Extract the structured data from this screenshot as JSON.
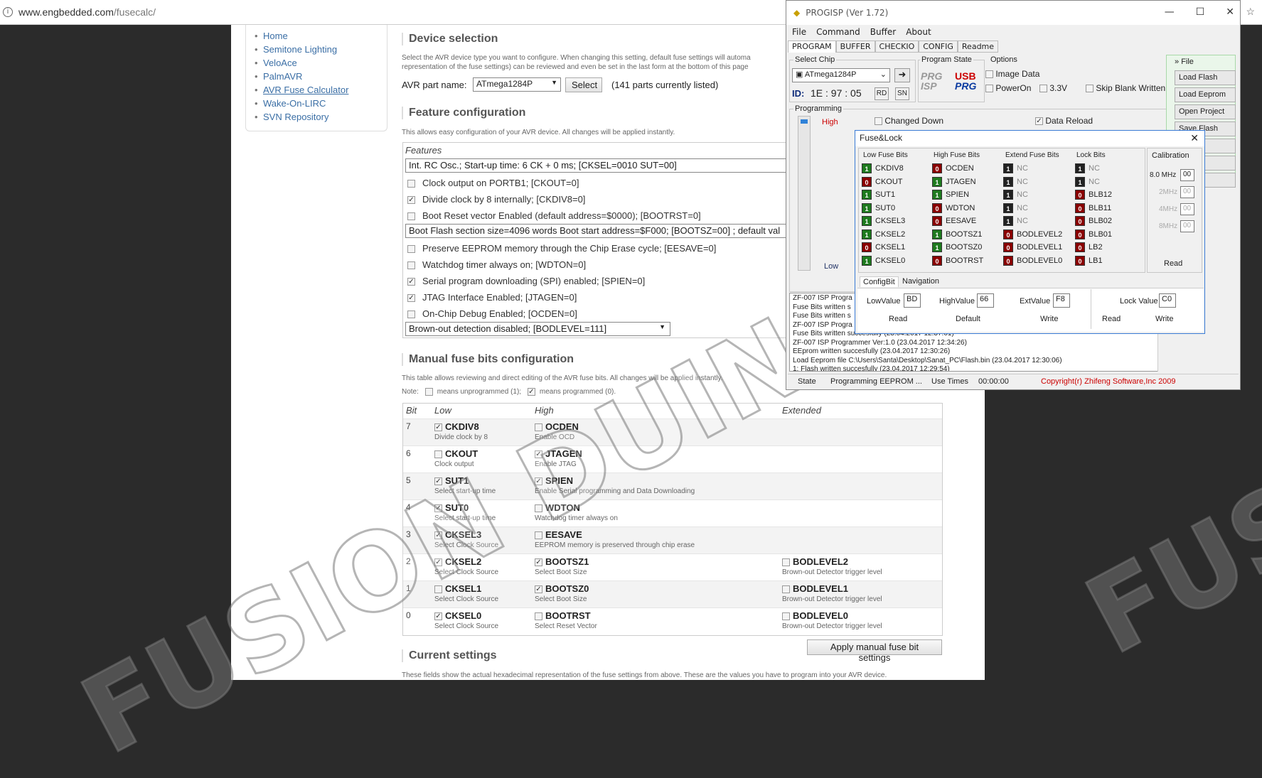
{
  "browser": {
    "url_host": "www.engbedded.com",
    "url_path": "/fusecalc/"
  },
  "sidenav": [
    "Home",
    "Semitone Lighting",
    "VeloAce",
    "PalmAVR",
    "AVR Fuse Calculator",
    "Wake-On-LIRC",
    "SVN Repository"
  ],
  "device": {
    "heading": "Device selection",
    "desc1": "Select the AVR device type you want to configure. When changing this setting, default fuse settings will automa",
    "desc2": "representation of the fuse settings) can be reviewed and even be set in the last form at the bottom of this page",
    "part_label": "AVR part name:",
    "part_value": "ATmega1284P",
    "select_btn": "Select",
    "count": "(141 parts currently listed)"
  },
  "features": {
    "heading": "Feature configuration",
    "desc": "This allows easy configuration of your AVR device. All changes will be applied instantly.",
    "box_label": "Features",
    "osc": "Int. RC Osc.; Start-up time: 6 CK + 0 ms; [CKSEL=0010 SUT=00]",
    "items": [
      {
        "text": "Clock output on PORTB1; [CKOUT=0]",
        "checked": false
      },
      {
        "text": "Divide clock by 8 internally; [CKDIV8=0]",
        "checked": true
      },
      {
        "text": "Boot Reset vector Enabled (default address=$0000); [BOOTRST=0]",
        "checked": false
      }
    ],
    "boot": "Boot Flash section size=4096 words Boot start address=$F000; [BOOTSZ=00] ; default val",
    "items2": [
      {
        "text": "Preserve EEPROM memory through the Chip Erase cycle; [EESAVE=0]",
        "checked": false
      },
      {
        "text": "Watchdog timer always on; [WDTON=0]",
        "checked": false
      },
      {
        "text": "Serial program downloading (SPI) enabled; [SPIEN=0]",
        "checked": true
      },
      {
        "text": "JTAG Interface Enabled; [JTAGEN=0]",
        "checked": true
      },
      {
        "text": "On-Chip Debug Enabled; [OCDEN=0]",
        "checked": false
      }
    ],
    "bod": "Brown-out detection disabled; [BODLEVEL=111]"
  },
  "manual": {
    "heading": "Manual fuse bits configuration",
    "desc": "This table allows reviewing and direct editing of the AVR fuse bits. All changes will be applied instantly.",
    "note": "Note:",
    "unprog": "means unprogrammed (1);",
    "prog": "means programmed (0).",
    "cols": [
      "Bit",
      "Low",
      "High",
      "Extended"
    ],
    "rows": [
      {
        "bit": "7",
        "low": {
          "n": "CKDIV8",
          "d": "Divide clock by 8",
          "c": true
        },
        "high": {
          "n": "OCDEN",
          "d": "Enable OCD",
          "c": false
        },
        "ext": null
      },
      {
        "bit": "6",
        "low": {
          "n": "CKOUT",
          "d": "Clock output",
          "c": false
        },
        "high": {
          "n": "JTAGEN",
          "d": "Enable JTAG",
          "c": true
        },
        "ext": null
      },
      {
        "bit": "5",
        "low": {
          "n": "SUT1",
          "d": "Select start-up time",
          "c": true
        },
        "high": {
          "n": "SPIEN",
          "d": "Enable Serial programming and Data Downloading",
          "c": true
        },
        "ext": null
      },
      {
        "bit": "4",
        "low": {
          "n": "SUT0",
          "d": "Select start-up time",
          "c": true
        },
        "high": {
          "n": "WDTON",
          "d": "Watchdog timer always on",
          "c": false
        },
        "ext": null
      },
      {
        "bit": "3",
        "low": {
          "n": "CKSEL3",
          "d": "Select Clock Source",
          "c": true
        },
        "high": {
          "n": "EESAVE",
          "d": "EEPROM memory is preserved through chip erase",
          "c": false
        },
        "ext": null
      },
      {
        "bit": "2",
        "low": {
          "n": "CKSEL2",
          "d": "Select Clock Source",
          "c": true
        },
        "high": {
          "n": "BOOTSZ1",
          "d": "Select Boot Size",
          "c": true
        },
        "ext": {
          "n": "BODLEVEL2",
          "d": "Brown-out Detector trigger level",
          "c": false
        }
      },
      {
        "bit": "1",
        "low": {
          "n": "CKSEL1",
          "d": "Select Clock Source",
          "c": false
        },
        "high": {
          "n": "BOOTSZ0",
          "d": "Select Boot Size",
          "c": true
        },
        "ext": {
          "n": "BODLEVEL1",
          "d": "Brown-out Detector trigger level",
          "c": false
        }
      },
      {
        "bit": "0",
        "low": {
          "n": "CKSEL0",
          "d": "Select Clock Source",
          "c": true
        },
        "high": {
          "n": "BOOTRST",
          "d": "Select Reset Vector",
          "c": false
        },
        "ext": {
          "n": "BODLEVEL0",
          "d": "Brown-out Detector trigger level",
          "c": false
        }
      }
    ],
    "apply_btn": "Apply manual fuse bit settings"
  },
  "current": {
    "heading": "Current settings",
    "desc": "These fields show the actual hexadecimal representation of the fuse settings from above. These are the values you have to program into your AVR device."
  },
  "progisp": {
    "title": "PROGISP (Ver 1.72)",
    "menu": [
      "File",
      "Command",
      "Buffer",
      "About"
    ],
    "tabs": [
      "PROGRAM",
      "BUFFER",
      "CHECKIO",
      "CONFIG",
      "Readme"
    ],
    "select_chip": "Select Chip",
    "chip": "ATmega1284P",
    "id_label": "ID:",
    "id_value": "1E : 97 : 05",
    "rd": "RD",
    "sn": "SN",
    "program_state": "Program State",
    "options": "Options",
    "opt_image": "Image Data",
    "opt_poweron": "PowerOn",
    "opt_33": "3.3V",
    "opt_skip": "Skip Blank Written",
    "programming": "Programming",
    "high": "High",
    "low": "Low",
    "changed_down": "Changed Down",
    "data_reload": "Data Reload",
    "side_header": "File",
    "side_buttons": [
      "Load Flash",
      "Load Eeprom",
      "Open Project",
      "Save Flash",
      "prom",
      "oject",
      "and"
    ],
    "log": [
      "ZF-007 ISP Progra",
      "Fuse Bits written s",
      "Fuse Bits written s",
      "ZF-007 ISP Progra",
      "Fuse Bits written succesfully (23.04.2017 12:37:01)",
      "ZF-007 ISP Programmer Ver:1.0 (23.04.2017 12:34:26)",
      "EEprom written succesfully (23.04.2017 12:30:26)",
      "Load Eeprom file C:\\Users\\Santa\\Desktop\\Sanat_PC\\Flash.bin (23.04.2017 12:30:06)",
      "1: Flash written succesfully (23.04.2017 12:29:54)"
    ],
    "status_state": "State",
    "status_prog": "Programming EEPROM ...",
    "status_use": "Use Times",
    "status_time": "00:00:00",
    "copyright": "Copyright(r) Zhifeng Software,Inc 2009"
  },
  "fuselock": {
    "title": "Fuse&Lock",
    "col_low": "Low Fuse Bits",
    "col_high": "High Fuse Bits",
    "col_ext": "Extend Fuse Bits",
    "col_lock": "Lock Bits",
    "col_cal": "Calibration",
    "low": [
      [
        "1",
        "CKDIV8",
        "g"
      ],
      [
        "0",
        "CKOUT",
        "r"
      ],
      [
        "1",
        "SUT1",
        "g"
      ],
      [
        "1",
        "SUT0",
        "g"
      ],
      [
        "1",
        "CKSEL3",
        "g"
      ],
      [
        "1",
        "CKSEL2",
        "g"
      ],
      [
        "0",
        "CKSEL1",
        "r"
      ],
      [
        "1",
        "CKSEL0",
        "g"
      ]
    ],
    "high": [
      [
        "0",
        "OCDEN",
        "r"
      ],
      [
        "1",
        "JTAGEN",
        "g"
      ],
      [
        "1",
        "SPIEN",
        "g"
      ],
      [
        "0",
        "WDTON",
        "r"
      ],
      [
        "0",
        "EESAVE",
        "r"
      ],
      [
        "1",
        "BOOTSZ1",
        "g"
      ],
      [
        "1",
        "BOOTSZ0",
        "g"
      ],
      [
        "0",
        "BOOTRST",
        "r"
      ]
    ],
    "ext": [
      [
        "1",
        "NC",
        "k"
      ],
      [
        "1",
        "NC",
        "k"
      ],
      [
        "1",
        "NC",
        "k"
      ],
      [
        "1",
        "NC",
        "k"
      ],
      [
        "1",
        "NC",
        "k"
      ],
      [
        "0",
        "BODLEVEL2",
        "r"
      ],
      [
        "0",
        "BODLEVEL1",
        "r"
      ],
      [
        "0",
        "BODLEVEL0",
        "r"
      ]
    ],
    "lock": [
      [
        "1",
        "NC",
        "k"
      ],
      [
        "1",
        "NC",
        "k"
      ],
      [
        "0",
        "BLB12",
        "r"
      ],
      [
        "0",
        "BLB11",
        "r"
      ],
      [
        "0",
        "BLB02",
        "r"
      ],
      [
        "0",
        "BLB01",
        "r"
      ],
      [
        "0",
        "LB2",
        "r"
      ],
      [
        "0",
        "LB1",
        "r"
      ]
    ],
    "cal": [
      [
        "8.0 MHz",
        "00"
      ],
      [
        "2MHz",
        "00"
      ],
      [
        "4MHz",
        "00"
      ],
      [
        "8MHz",
        "00"
      ]
    ],
    "cal_read": "Read",
    "tab_config": "ConfigBit",
    "tab_nav": "Navigation",
    "low_label": "LowValue",
    "low_val": "BD",
    "high_label": "HighValue",
    "high_val": "66",
    "ext_label": "ExtValue",
    "ext_val": "F8",
    "lock_label": "Lock Value",
    "lock_val": "C0",
    "read": "Read",
    "default": "Default",
    "write": "Write"
  },
  "watermark": "FUSION DUINO.RU",
  "watermark_right": "FUSI"
}
